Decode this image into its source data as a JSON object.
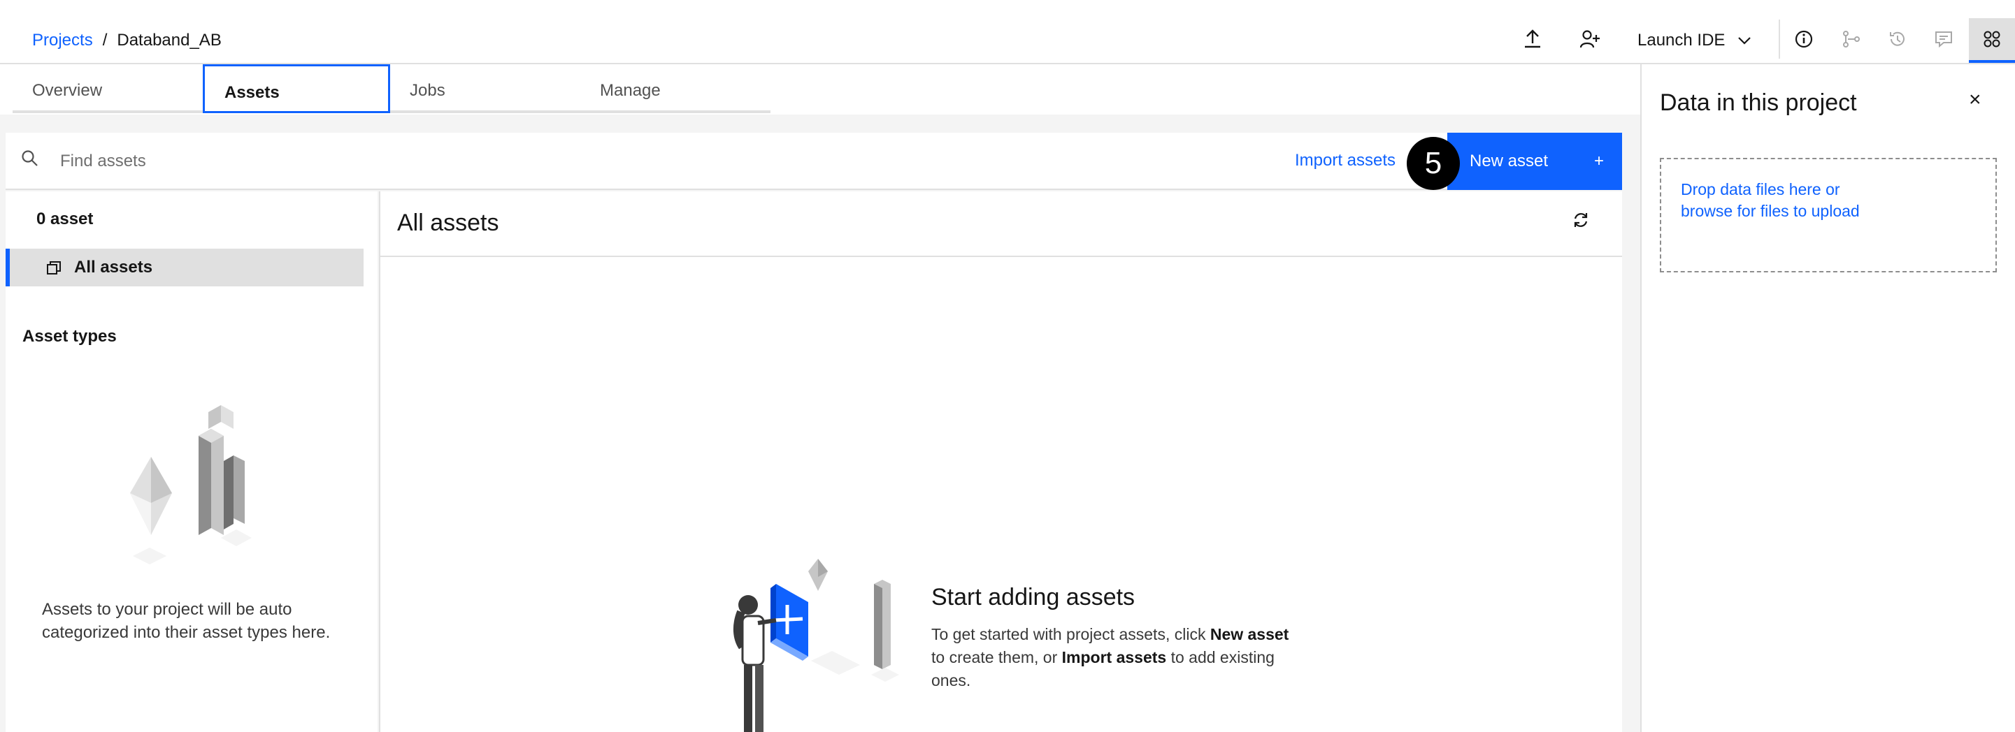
{
  "breadcrumb": {
    "root": "Projects",
    "separator": "/",
    "current": "Databand_AB"
  },
  "header": {
    "launch_ide_label": "Launch IDE",
    "icons": [
      "upload-icon",
      "add-collaborator-icon",
      "chevron-down-icon",
      "info-icon",
      "lineage-icon",
      "history-icon",
      "comment-icon",
      "data-panel-icon"
    ]
  },
  "tabs": [
    "Overview",
    "Assets",
    "Jobs",
    "Manage"
  ],
  "active_tab": "Assets",
  "toolbar": {
    "search_placeholder": "Find assets",
    "import_label": "Import assets",
    "new_asset_label": "New asset",
    "new_asset_plus": "+",
    "step_badge": "5"
  },
  "sidebar": {
    "asset_count": "0 asset",
    "all_assets_label": "All assets",
    "asset_types_heading": "Asset types",
    "note": "Assets to your project will be auto categorized into their asset types here."
  },
  "content": {
    "title": "All assets",
    "empty_title": "Start adding assets",
    "empty_desc_1": "To get started with project assets, click ",
    "empty_desc_bold_1": "New asset",
    "empty_desc_2": " to create them, or ",
    "empty_desc_bold_2": "Import assets",
    "empty_desc_3": " to add existing ones."
  },
  "right_panel": {
    "title": "Data in this project",
    "close": "×",
    "dropzone_line1": "Drop data files here or",
    "dropzone_line2": "browse for files to upload"
  },
  "colors": {
    "accent": "#0f62fe",
    "background": "#f4f4f4",
    "border": "#e0e0e0"
  }
}
